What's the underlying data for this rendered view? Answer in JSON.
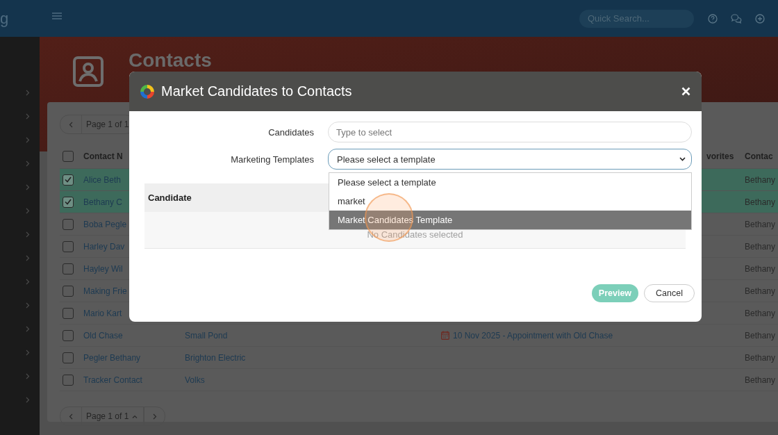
{
  "topbar": {
    "brand_fragment": "g",
    "search": {
      "placeholder": "Quick Search..."
    }
  },
  "page": {
    "title": "Contacts"
  },
  "pager_top": {
    "label": "Page 1 of 1"
  },
  "table": {
    "header_checked": false,
    "columns": [
      "Contact N",
      "vorites",
      "Contac"
    ],
    "rows": [
      {
        "checked": true,
        "selected": true,
        "name": "Alice Beth",
        "owner": "Bethany"
      },
      {
        "checked": true,
        "selected": true,
        "name": "Bethany C",
        "owner": "Bethany"
      },
      {
        "checked": false,
        "selected": false,
        "name": "Boba Pegle",
        "owner": "Bethany"
      },
      {
        "checked": false,
        "selected": false,
        "name": "Harley Dav",
        "owner": "Bethany"
      },
      {
        "checked": false,
        "selected": false,
        "name": "Hayley Wil",
        "owner": "Bethany"
      },
      {
        "checked": false,
        "selected": false,
        "name": "Making Frie",
        "owner": "Bethany"
      },
      {
        "checked": false,
        "selected": false,
        "name": "Mario Kart",
        "owner": "Bethany"
      },
      {
        "checked": false,
        "selected": false,
        "name": "Old Chase",
        "company": "Small Pond",
        "appointment": "10 Nov 2025 - Appointment with Old Chase",
        "owner": "Bethany"
      },
      {
        "checked": false,
        "selected": false,
        "name": "Pegler Bethany",
        "company": "Brighton Electric",
        "owner": "Bethany"
      },
      {
        "checked": false,
        "selected": false,
        "name": "Tracker Contact",
        "company": "Volks",
        "owner": "Bethany"
      }
    ]
  },
  "pager_bottom": {
    "label": "Page 1 of 1"
  },
  "dialog": {
    "title": "Market Candidates to Contacts",
    "fields": [
      {
        "label": "Candidates",
        "kind": "text",
        "placeholder": "Type to select"
      },
      {
        "label": "Marketing Templates",
        "kind": "select",
        "value": "Please select a template",
        "expanded": true,
        "options": [
          {
            "label": "Please select a template",
            "highlighted": false
          },
          {
            "label": "market",
            "highlighted": false
          },
          {
            "label": "Market Candidates Template",
            "highlighted": true
          }
        ]
      }
    ],
    "candidate_table": {
      "columns": [
        "Candidate"
      ],
      "empty_text": "No Candidates selected"
    },
    "buttons": [
      {
        "label": "Preview",
        "kind": "primary"
      },
      {
        "label": "Cancel",
        "kind": "secondary"
      }
    ]
  }
}
